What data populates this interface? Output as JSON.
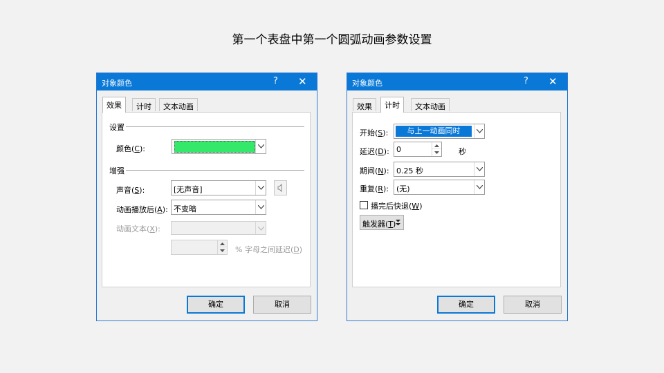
{
  "slide_title": "第一个表盘中第一个圆弧动画参数设置",
  "dialog_left": {
    "title": "对象颜色",
    "help_glyph": "?",
    "close_glyph": "✕",
    "tabs": [
      "效果",
      "计时",
      "文本动画"
    ],
    "active_tab": "效果",
    "settings_header": "设置",
    "color_label": "颜色(",
    "color_key": "C",
    "color_value": "#34e86a",
    "enhance_header": "增强",
    "sound_label": "声音(",
    "sound_key": "S",
    "sound_value": "[无声音]",
    "after_anim_label": "动画播放后(",
    "after_anim_key": "A",
    "after_anim_value": "不变暗",
    "anim_text_label": "动画文本(",
    "anim_text_key": "X",
    "anim_text_value": "",
    "letter_delay_text": "% 字母之间延迟(",
    "letter_delay_key": "D",
    "letter_delay_value": "",
    "ok_label": "确定",
    "cancel_label": "取消"
  },
  "dialog_right": {
    "title": "对象颜色",
    "help_glyph": "?",
    "close_glyph": "✕",
    "tabs": [
      "效果",
      "计时",
      "文本动画"
    ],
    "active_tab": "计时",
    "start_label": "开始(",
    "start_key": "S",
    "start_value": "与上一动画同时",
    "delay_label": "延迟(",
    "delay_key": "D",
    "delay_value": "0",
    "delay_unit": "秒",
    "duration_label": "期间(",
    "duration_key": "N",
    "duration_value": "0.25 秒",
    "repeat_label": "重复(",
    "repeat_key": "R",
    "repeat_value": "(无)",
    "rewind_label": "播完后快退(",
    "rewind_key": "W",
    "rewind_checked": false,
    "triggers_label": "触发器(",
    "triggers_key": "T",
    "ok_label": "确定",
    "cancel_label": "取消"
  }
}
